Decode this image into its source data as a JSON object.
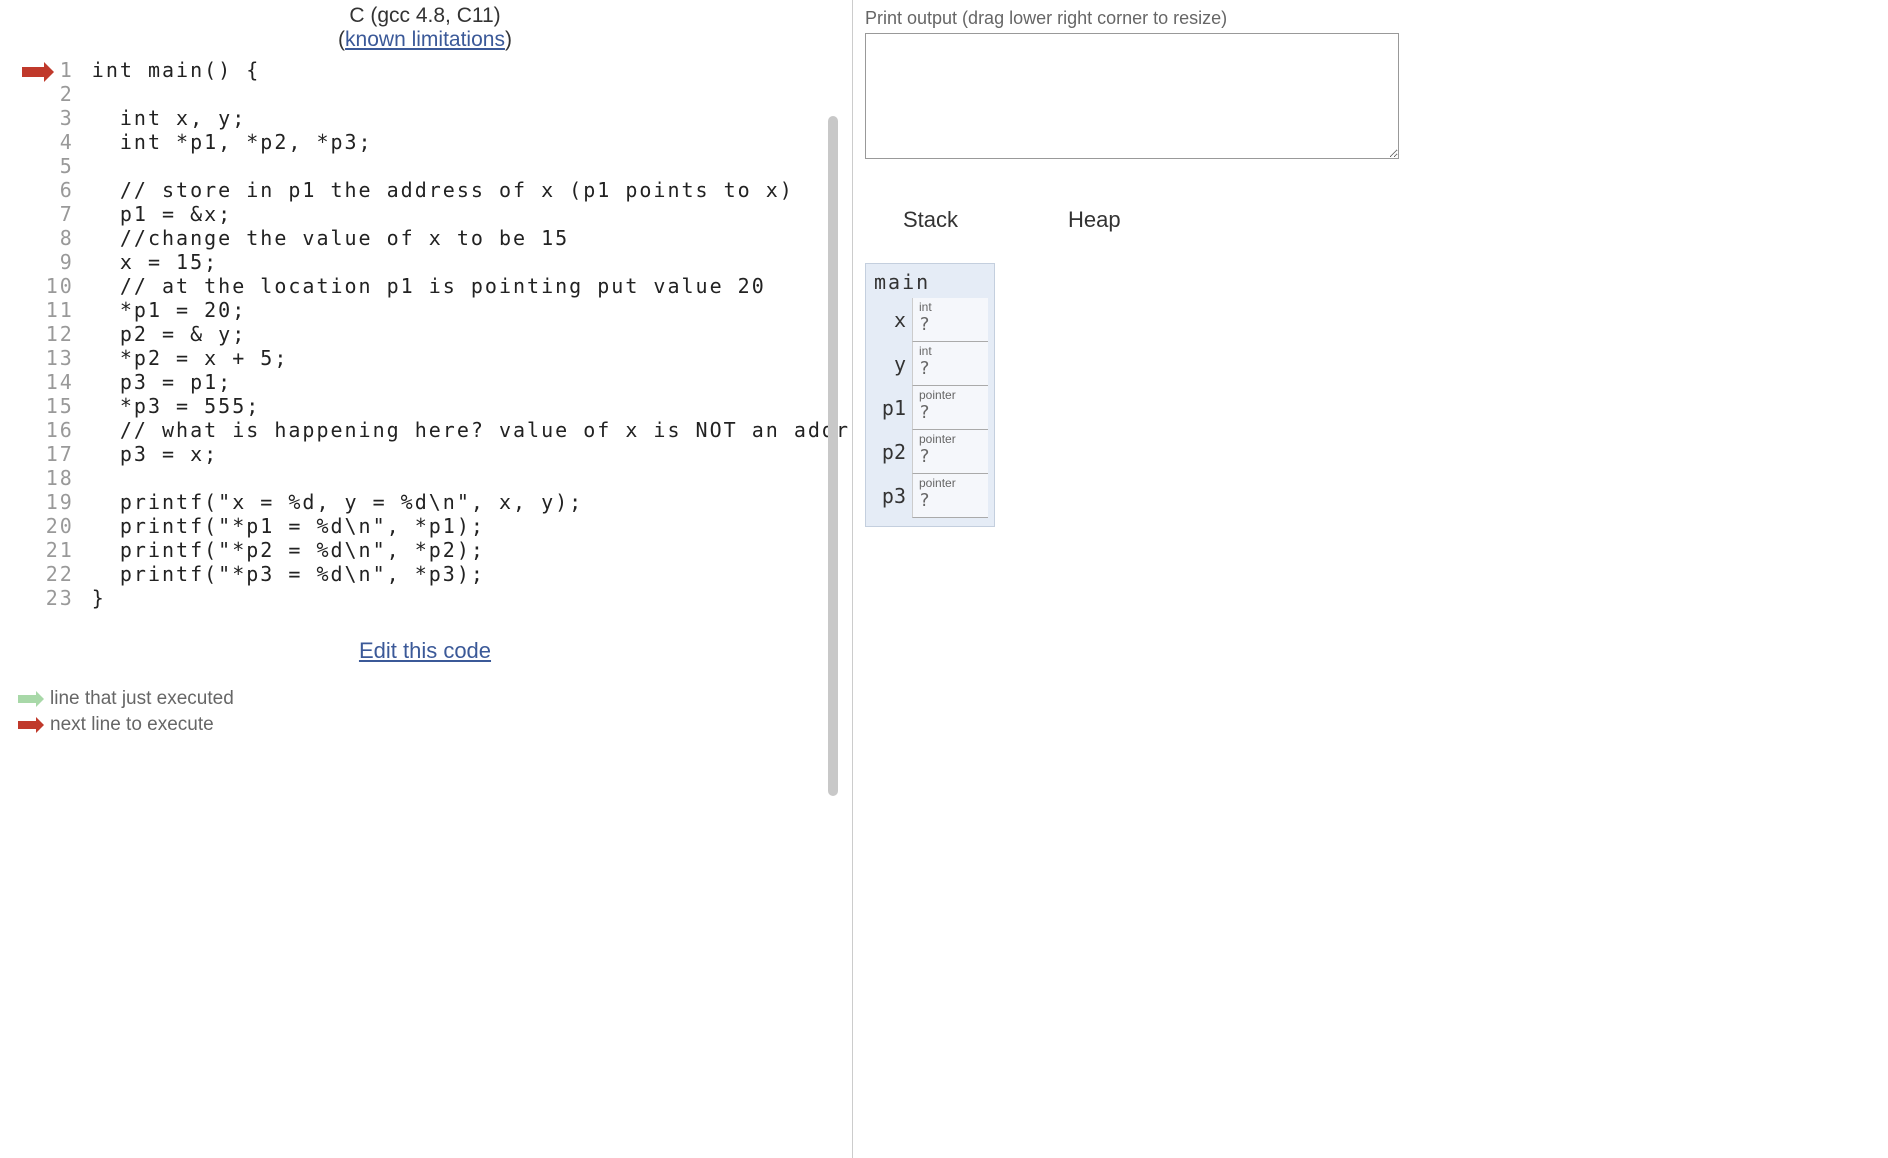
{
  "header": {
    "language": "C (gcc 4.8, C11)",
    "link_prefix": "(",
    "link_text": "known limitations",
    "link_suffix": ")"
  },
  "code": {
    "current_arrow_line": 1,
    "lines": [
      "int main() {",
      "",
      "  int x, y;",
      "  int *p1, *p2, *p3;",
      "",
      "  // store in p1 the address of x (p1 points to x)",
      "  p1 = &x;",
      "  //change the value of x to be 15",
      "  x = 15;",
      "  // at the location p1 is pointing put value 20",
      "  *p1 = 20;",
      "  p2 = & y;",
      "  *p2 = x + 5;",
      "  p3 = p1;",
      "  *p3 = 555;",
      "  // what is happening here? value of x is NOT an addr",
      "  p3 = x;",
      "",
      "  printf(\"x = %d, y = %d\\n\", x, y);",
      "  printf(\"*p1 = %d\\n\", *p1);",
      "  printf(\"*p2 = %d\\n\", *p2);",
      "  printf(\"*p3 = %d\\n\", *p3);",
      "}"
    ]
  },
  "edit_link": "Edit this code",
  "legend": {
    "executed": "line that just executed",
    "next": "next line to execute"
  },
  "output": {
    "label": "Print output (drag lower right corner to resize)",
    "text": ""
  },
  "memory": {
    "stack_label": "Stack",
    "heap_label": "Heap",
    "frame_name": "main",
    "vars": [
      {
        "name": "x",
        "type": "int",
        "value": "?"
      },
      {
        "name": "y",
        "type": "int",
        "value": "?"
      },
      {
        "name": "p1",
        "type": "pointer",
        "value": "?"
      },
      {
        "name": "p2",
        "type": "pointer",
        "value": "?"
      },
      {
        "name": "p3",
        "type": "pointer",
        "value": "?"
      }
    ]
  }
}
